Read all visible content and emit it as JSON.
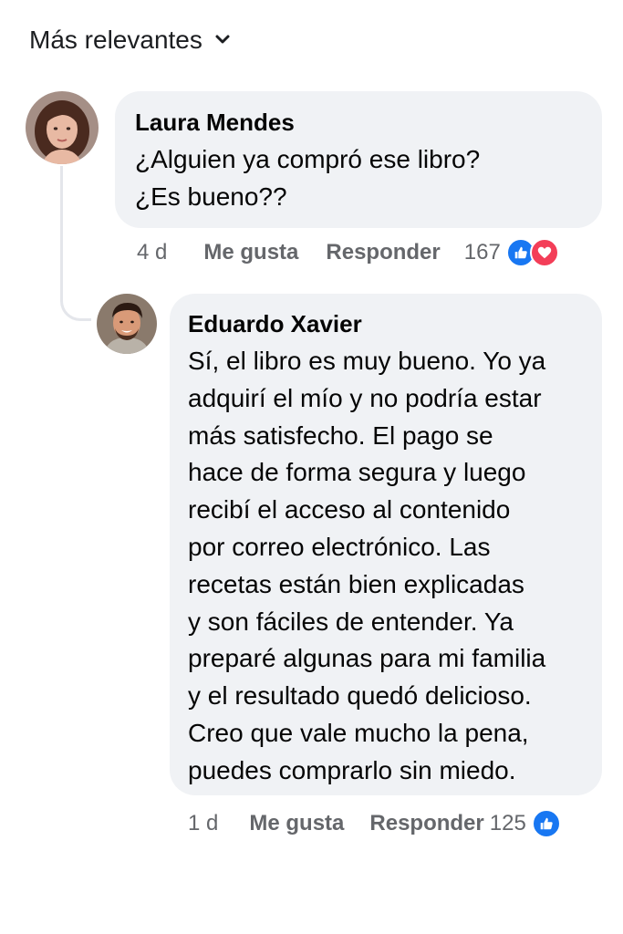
{
  "sort": {
    "label": "Más relevantes"
  },
  "comments": [
    {
      "author": "Laura Mendes",
      "text": "¿Alguien ya compró ese libro?\n¿Es bueno??",
      "time": "4 d",
      "like_label": "Me gusta",
      "reply_label": "Responder",
      "reaction_count": "167",
      "reactions": [
        "like-icon",
        "love-icon"
      ]
    },
    {
      "author": "Eduardo Xavier",
      "text": "Sí, el libro es muy bueno. Yo ya\nadquirí el mío y no podría estar\nmás satisfecho. El pago se\nhace de forma segura y luego\nrecibí el acceso al contenido\npor correo electrónico. Las\nrecetas están bien explicadas\ny son fáciles de entender. Ya\npreparé algunas para mi familia\ny el resultado quedó delicioso.\nCreo que vale mucho la pena,\npuedes comprarlo sin miedo.",
      "time": "1 d",
      "like_label": "Me gusta",
      "reply_label": "Responder",
      "reaction_count": "125",
      "reactions": [
        "like-icon"
      ]
    }
  ],
  "colors": {
    "like": "#1877f2",
    "love": "#f33e58",
    "bubble": "#f0f2f5",
    "meta": "#65676b"
  }
}
